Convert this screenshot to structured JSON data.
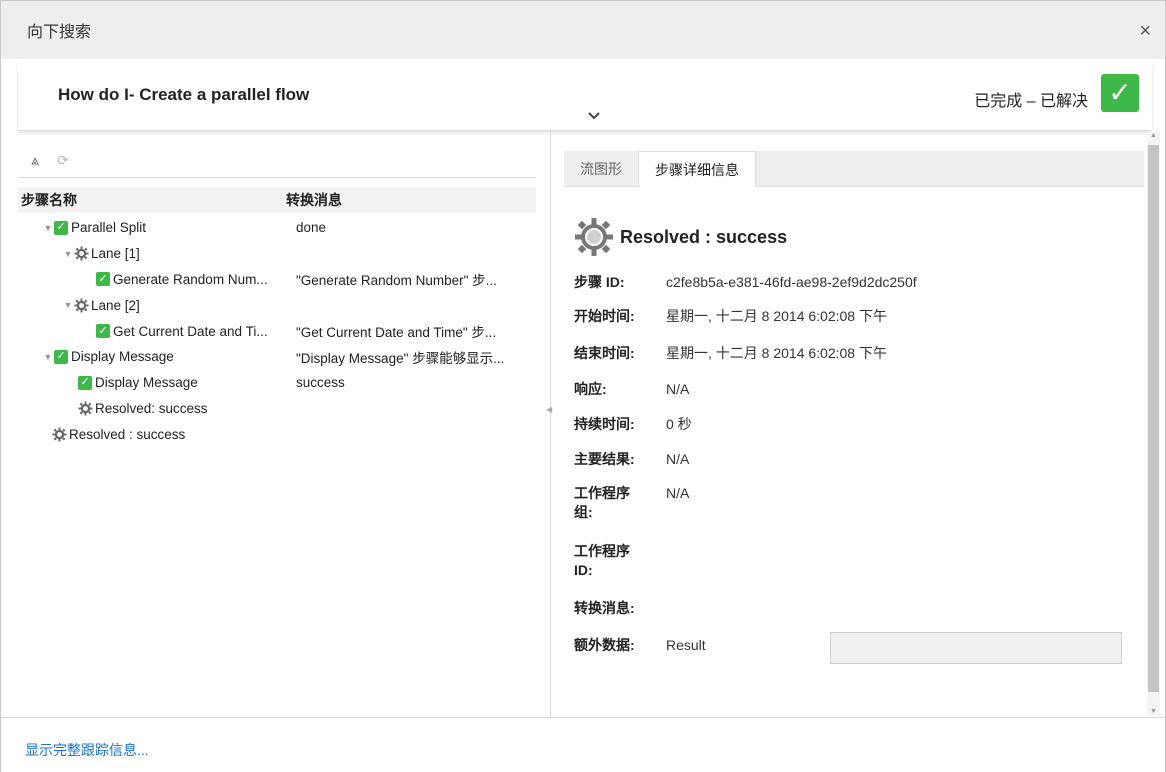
{
  "dialog": {
    "title": "向下搜索",
    "close_icon": "×"
  },
  "summary": {
    "flow_name": "How do I- Create a parallel flow",
    "status_text": "已完成 – 已解决",
    "status_check": "✓"
  },
  "toolbar": {
    "collapse_all": "⩓",
    "replay": "⟳"
  },
  "tree": {
    "col_name": "步骤名称",
    "col_message": "转换消息",
    "rows": [
      {
        "label": "Parallel Split",
        "message": "done"
      },
      {
        "label": "Lane [1]",
        "message": ""
      },
      {
        "label": "Generate Random Num...",
        "message": "\"Generate Random Number\" 步..."
      },
      {
        "label": "Lane [2]",
        "message": ""
      },
      {
        "label": "Get Current Date and Ti...",
        "message": "\"Get Current Date and Time\" 步..."
      },
      {
        "label": "Display Message",
        "message": "\"Display Message\" 步骤能够显示..."
      },
      {
        "label": "Display Message",
        "message": "success"
      },
      {
        "label": "Resolved: success",
        "message": ""
      },
      {
        "label": "Resolved : success",
        "message": ""
      }
    ]
  },
  "tabs": [
    {
      "label": "流图形"
    },
    {
      "label": "步骤详细信息"
    }
  ],
  "details": {
    "title": "Resolved : success",
    "step_id_label": "步骤 ID:",
    "step_id": "c2fe8b5a-e381-46fd-ae98-2ef9d2dc250f",
    "start_label": "开始时间:",
    "start": "星期一, 十二月 8 2014 6:02:08 下午",
    "end_label": "结束时间:",
    "end": "星期一, 十二月 8 2014 6:02:08 下午",
    "response_label": "响应:",
    "response": "N/A",
    "duration_label": "持续时间:",
    "duration": "0 秒",
    "primary_result_label": "主要结果:",
    "primary_result": "N/A",
    "worker_group_label_1": "工作程序",
    "worker_group_label_2": "组:",
    "worker_group": "N/A",
    "worker_id_label_1": "工作程序",
    "worker_id_label_2": "ID:",
    "transition_label": "转换消息:",
    "extra_label": "额外数据:",
    "extra_key": "Result",
    "extra_value": ""
  },
  "footer": {
    "link": "显示完整跟踪信息..."
  },
  "colors": {
    "accent": "#3fb84a",
    "link": "#1a73c8"
  }
}
